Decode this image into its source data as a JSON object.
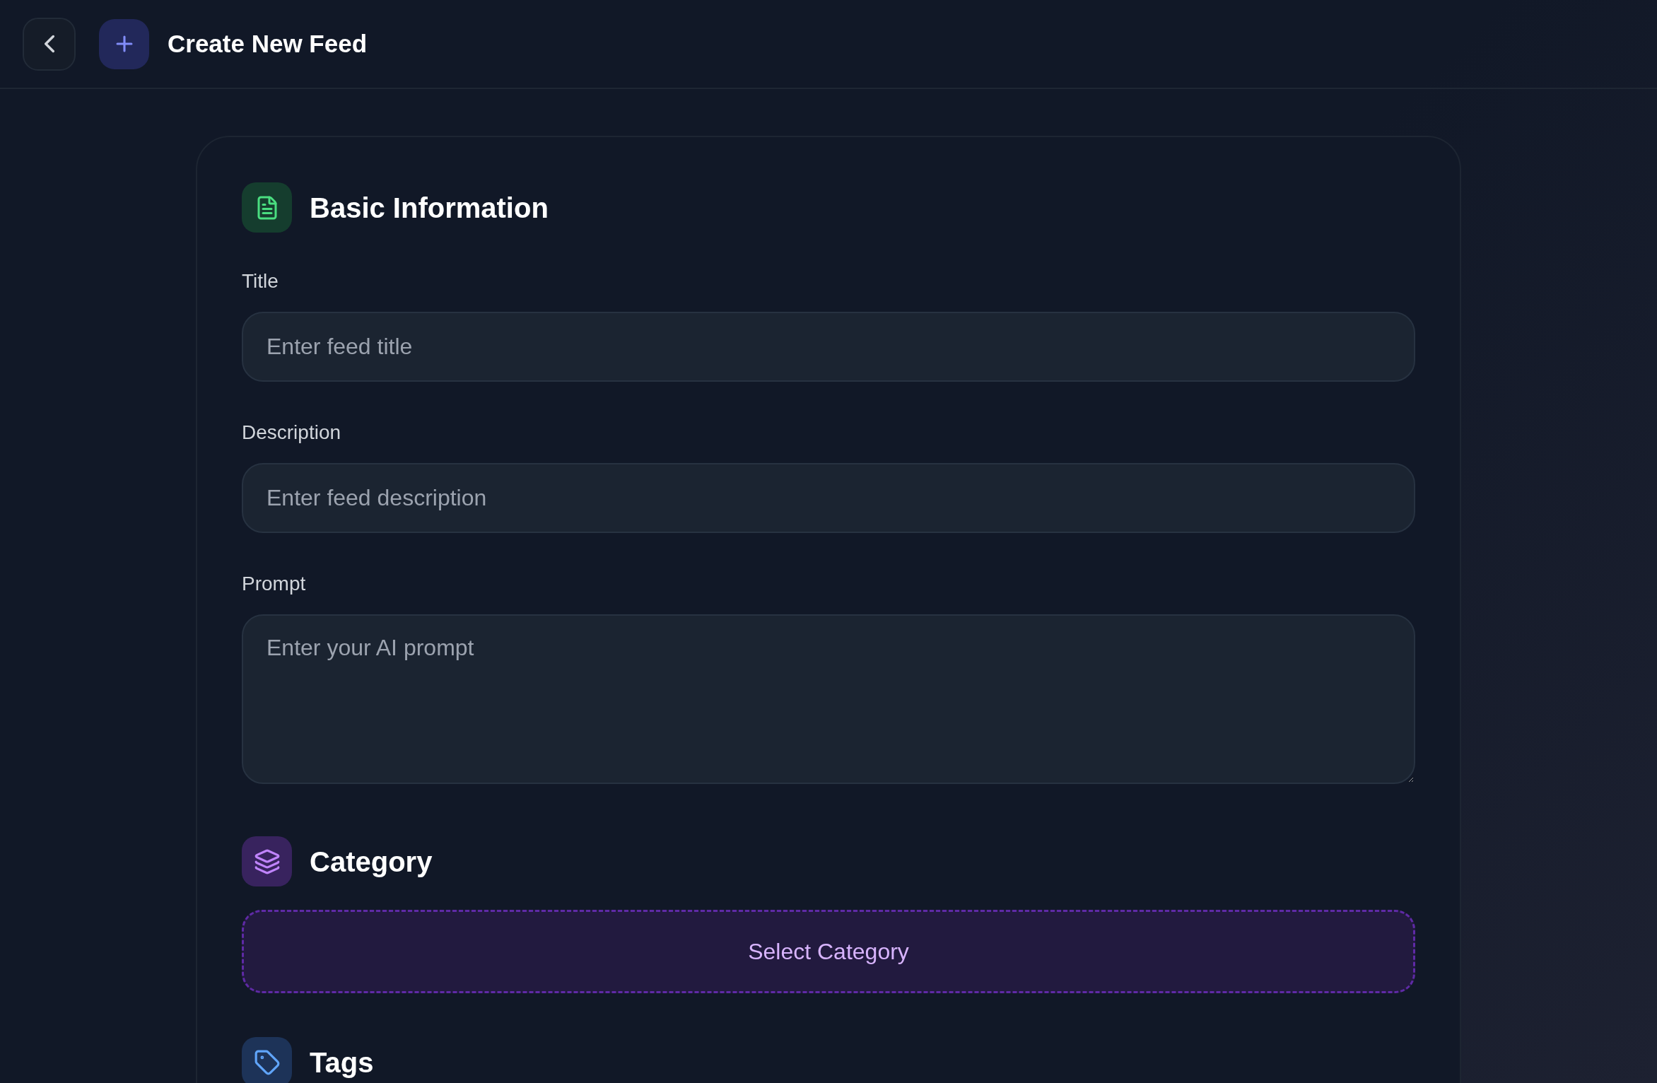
{
  "header": {
    "title": "Create New Feed"
  },
  "basic_information": {
    "heading": "Basic Information",
    "fields": [
      {
        "kind": "input",
        "label": "Title",
        "placeholder": "Enter feed title"
      },
      {
        "kind": "input",
        "label": "Description",
        "placeholder": "Enter feed description"
      },
      {
        "kind": "textarea",
        "label": "Prompt",
        "placeholder": "Enter your AI prompt"
      }
    ]
  },
  "category": {
    "heading": "Category",
    "button": "Select Category"
  },
  "tags": {
    "heading": "Tags"
  }
}
